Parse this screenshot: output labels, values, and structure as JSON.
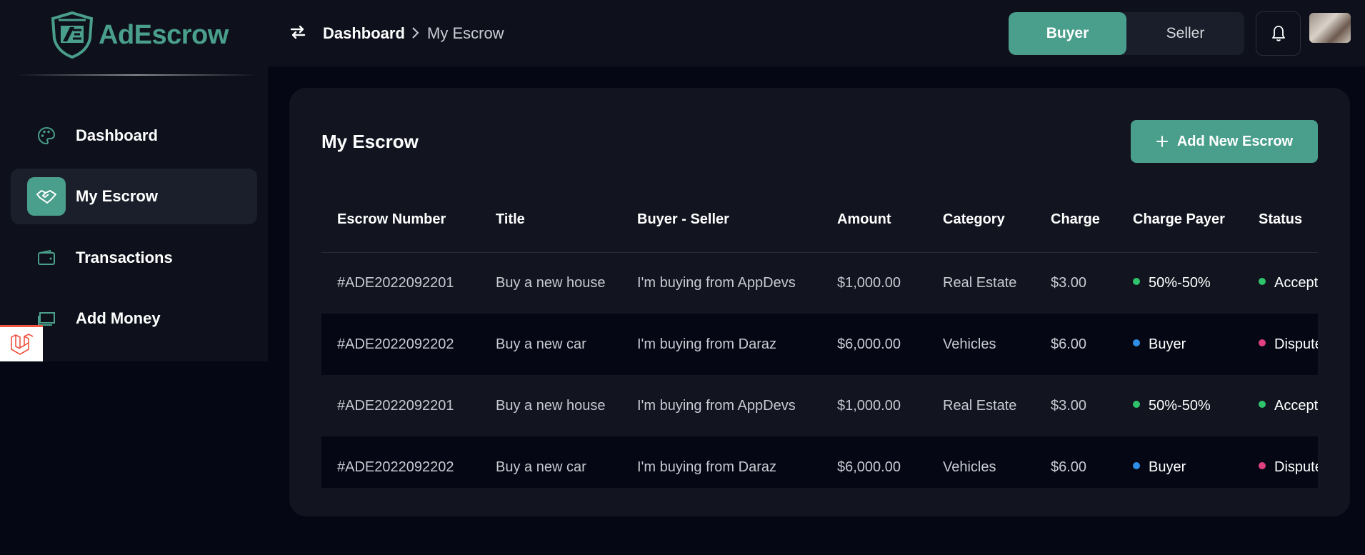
{
  "brand": {
    "name": "AdEscrow",
    "color": "#4a9e8c"
  },
  "sidebar": {
    "items": [
      {
        "label": "Dashboard",
        "icon": "palette-icon",
        "active": false
      },
      {
        "label": "My Escrow",
        "icon": "handshake-icon",
        "active": true
      },
      {
        "label": "Transactions",
        "icon": "wallet-icon",
        "active": false
      },
      {
        "label": "Add Money",
        "icon": "money-stack-icon",
        "active": false
      }
    ]
  },
  "header": {
    "breadcrumb": {
      "root": "Dashboard",
      "current": "My Escrow"
    },
    "role_toggle": {
      "buyer": "Buyer",
      "seller": "Seller",
      "selected": "Buyer"
    }
  },
  "main": {
    "title": "My Escrow",
    "add_button": "Add New Escrow",
    "table": {
      "columns": [
        "Escrow Number",
        "Title",
        "Buyer - Seller",
        "Amount",
        "Category",
        "Charge",
        "Charge Payer",
        "Status"
      ],
      "rows": [
        {
          "number": "#ADE2022092201",
          "title": "Buy a new house",
          "parties": "I'm buying from AppDevs",
          "amount": "$1,000.00",
          "category": "Real Estate",
          "charge": "$3.00",
          "payer": "50%-50%",
          "payer_color": "#2fc36b",
          "status": "Accepted",
          "status_color": "#2fc36b"
        },
        {
          "number": "#ADE2022092202",
          "title": "Buy a new car",
          "parties": "I'm buying from Daraz",
          "amount": "$6,000.00",
          "category": "Vehicles",
          "charge": "$6.00",
          "payer": "Buyer",
          "payer_color": "#2f8ee5",
          "status": "Disputed",
          "status_color": "#e0407f"
        },
        {
          "number": "#ADE2022092201",
          "title": "Buy a new house",
          "parties": "I'm buying from AppDevs",
          "amount": "$1,000.00",
          "category": "Real Estate",
          "charge": "$3.00",
          "payer": "50%-50%",
          "payer_color": "#2fc36b",
          "status": "Accepted",
          "status_color": "#2fc36b"
        },
        {
          "number": "#ADE2022092202",
          "title": "Buy a new car",
          "parties": "I'm buying from Daraz",
          "amount": "$6,000.00",
          "category": "Vehicles",
          "charge": "$6.00",
          "payer": "Buyer",
          "payer_color": "#2f8ee5",
          "status": "Disputed",
          "status_color": "#e0407f"
        }
      ]
    }
  },
  "colors": {
    "accent": "#4a9e8c",
    "background": "#050814",
    "panel": "#0e111b",
    "card": "#121520"
  }
}
